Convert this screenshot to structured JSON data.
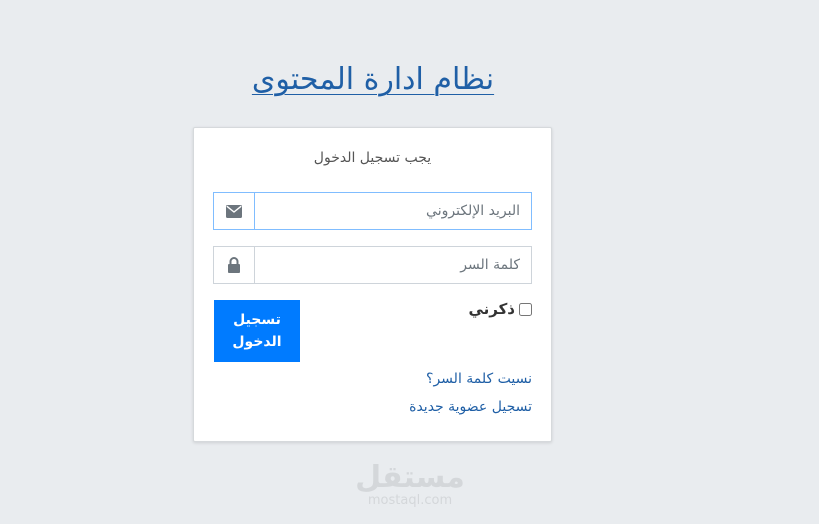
{
  "page": {
    "title": "نظام ادارة المحتوى"
  },
  "login": {
    "message": "يجب تسجيل الدخول",
    "email": {
      "placeholder": "البريد الإلكتروني",
      "icon": "envelope-icon"
    },
    "password": {
      "placeholder": "كلمة السر",
      "icon": "lock-icon"
    },
    "remember_label": "ذكرني",
    "submit_label": "تسجيل الدخول",
    "forgot_link": "نسيت كلمة السر؟",
    "register_link": "تسجيل عضوية جديدة"
  },
  "watermark": {
    "arabic": "مستقل",
    "latin": "mostaql.com"
  },
  "colors": {
    "primary": "#007bff",
    "link": "#1f5fa6",
    "background": "#e9ecef"
  }
}
